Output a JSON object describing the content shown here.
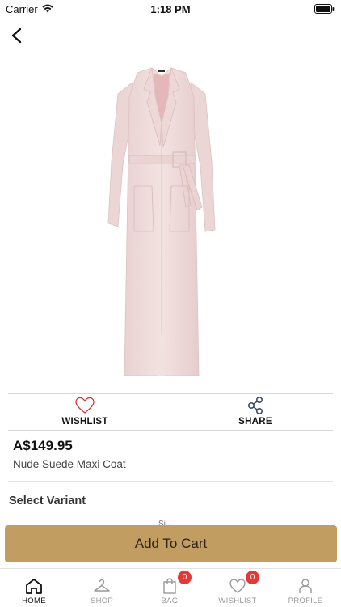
{
  "status_bar": {
    "carrier": "Carrier",
    "time": "1:18 PM"
  },
  "nav": {
    "back_icon": "chevron-left-icon"
  },
  "product": {
    "image_description_icon": "coat-image",
    "price": "A$149.95",
    "name": "Nude Suede Maxi Coat"
  },
  "actions": {
    "wishlist_label": "WISHLIST",
    "share_label": "SHARE"
  },
  "variant": {
    "title": "Select Variant",
    "partial_text": "Si..."
  },
  "cart": {
    "button_label": "Add To Cart"
  },
  "tabs": [
    {
      "label": "HOME",
      "icon": "home-icon",
      "active": true
    },
    {
      "label": "SHOP",
      "icon": "hanger-icon",
      "active": false
    },
    {
      "label": "BAG",
      "icon": "bag-icon",
      "active": false,
      "badge": "0"
    },
    {
      "label": "WISHLIST",
      "icon": "heart-icon",
      "active": false,
      "badge": "0"
    },
    {
      "label": "PROFILE",
      "icon": "person-icon",
      "active": false
    }
  ],
  "colors": {
    "accent": "#c19d61",
    "badge": "#e53935",
    "wishlist_heart": "#d32f2f",
    "share_icon": "#3a4a6b"
  }
}
